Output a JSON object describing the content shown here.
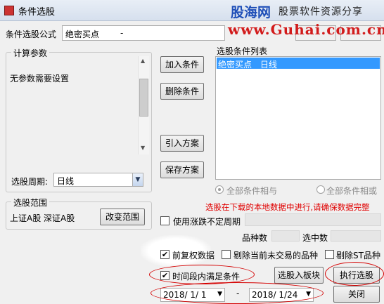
{
  "window": {
    "title": "条件选股"
  },
  "watermark": {
    "brand": "股海网",
    "slogan": "股票软件资源分享",
    "url": "www.Guhai.com.cn"
  },
  "formula": {
    "label": "条件选股公式",
    "value": "绝密买点",
    "dash": "-"
  },
  "params": {
    "legend": "计算参数",
    "message": "无参数需要设置",
    "period_label": "选股周期:",
    "period_value": "日线"
  },
  "buttons": {
    "add": "加入条件",
    "remove": "删除条件",
    "import": "引入方案",
    "save": "保存方案",
    "change_range": "改变范围",
    "to_block": "选股入板块",
    "execute": "执行选股",
    "close": "关闭"
  },
  "condition_list": {
    "label": "选股条件列表",
    "items": [
      {
        "name": "绝密买点",
        "period": "日线"
      }
    ]
  },
  "logic": {
    "all_and": "全部条件相与",
    "all_or": "全部条件相或"
  },
  "notice": "选股在下载的本地数据中进行,请确保数据完整",
  "range": {
    "legend": "选股范围",
    "text": "上证A股 深证A股"
  },
  "options": {
    "use_limit_period": "使用涨跌不定周期",
    "stock_count": "品种数",
    "selected_count": "选中数",
    "pre_adjust": "前复权数据",
    "exclude_untraded": "剔除当前未交易的品种",
    "exclude_st": "剔除ST品种",
    "time_range": "时间段内满足条件"
  },
  "dates": {
    "start": "2018/ 1/ 1",
    "separator": "-",
    "end": "2018/ 1/24"
  },
  "colors": {
    "selection": "#3399ff",
    "notice": "#e00000",
    "annotation": "#d40000"
  }
}
